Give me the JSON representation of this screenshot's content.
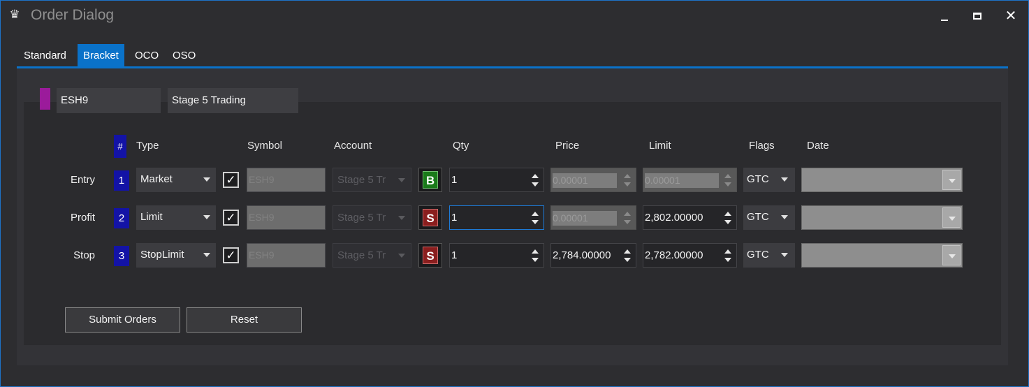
{
  "window": {
    "title": "Order Dialog",
    "app_icon": "platform-logo-icon",
    "minimize_icon": "minimize-icon",
    "maximize_icon": "maximize-icon",
    "close_icon": "close-icon",
    "close_glyph": "✕"
  },
  "tabs": [
    {
      "label": "Standard",
      "active": false
    },
    {
      "label": "Bracket",
      "active": true
    },
    {
      "label": "OCO",
      "active": false
    },
    {
      "label": "OSO",
      "active": false
    }
  ],
  "header": {
    "symbol": "ESH9",
    "symbol_color": "#9b1b9b",
    "account": "Stage 5 Trading"
  },
  "columns": {
    "hash": "#",
    "type": "Type",
    "symbol": "Symbol",
    "account": "Account",
    "qty": "Qty",
    "price": "Price",
    "limit": "Limit",
    "flags": "Flags",
    "date": "Date"
  },
  "rows": [
    {
      "label": "Entry",
      "num": "1",
      "type": "Market",
      "checked": true,
      "symbol": "ESH9",
      "account": "Stage 5 Tr",
      "side": "B",
      "qty": "1",
      "price": "0.00001",
      "price_disabled": true,
      "limit": "0.00001",
      "limit_disabled": true,
      "flag": "GTC",
      "date": ""
    },
    {
      "label": "Profit",
      "num": "2",
      "type": "Limit",
      "checked": true,
      "symbol": "ESH9",
      "account": "Stage 5 Tr",
      "side": "S",
      "qty": "1",
      "price": "0.00001",
      "price_disabled": true,
      "limit": "2,802.00000",
      "limit_disabled": false,
      "flag": "GTC",
      "date": ""
    },
    {
      "label": "Stop",
      "num": "3",
      "type": "StopLimit",
      "checked": true,
      "symbol": "ESH9",
      "account": "Stage 5 Tr",
      "side": "S",
      "qty": "1",
      "price": "2,784.00000",
      "price_disabled": false,
      "limit": "2,782.00000",
      "limit_disabled": false,
      "flag": "GTC",
      "date": ""
    }
  ],
  "buttons": {
    "submit": "Submit Orders",
    "reset": "Reset"
  },
  "colors": {
    "accent": "#0a72c9",
    "buy": "#1a7a1a",
    "sell": "#8a1e1e",
    "row_number": "#1313a6"
  }
}
